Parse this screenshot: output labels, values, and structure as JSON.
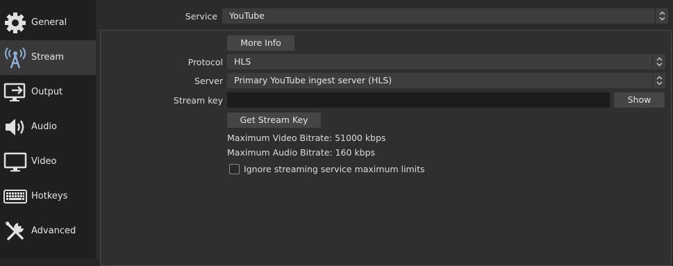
{
  "sidebar": {
    "items": [
      {
        "label": "General",
        "icon": "gear-icon"
      },
      {
        "label": "Stream",
        "icon": "broadcast-tower-icon"
      },
      {
        "label": "Output",
        "icon": "monitor-output-icon"
      },
      {
        "label": "Audio",
        "icon": "speaker-icon"
      },
      {
        "label": "Video",
        "icon": "monitor-icon"
      },
      {
        "label": "Hotkeys",
        "icon": "keyboard-icon"
      },
      {
        "label": "Advanced",
        "icon": "wrench-screwdriver-icon"
      }
    ],
    "active": "Stream"
  },
  "service": {
    "label": "Service",
    "value": "YouTube"
  },
  "more_info_label": "More Info",
  "protocol": {
    "label": "Protocol",
    "value": "HLS"
  },
  "server": {
    "label": "Server",
    "value": "Primary YouTube ingest server (HLS)"
  },
  "stream_key": {
    "label": "Stream key",
    "value": "",
    "show_label": "Show"
  },
  "get_stream_key_label": "Get Stream Key",
  "max_video_bitrate": "Maximum Video Bitrate: 51000 kbps",
  "max_audio_bitrate": "Maximum Audio Bitrate: 160 kbps",
  "ignore_limits": {
    "label": "Ignore streaming service maximum limits",
    "checked": false
  },
  "colors": {
    "sidebar_bg": "#1f1f1f",
    "active_bg": "#393939",
    "main_bg": "#2b2b2b"
  }
}
